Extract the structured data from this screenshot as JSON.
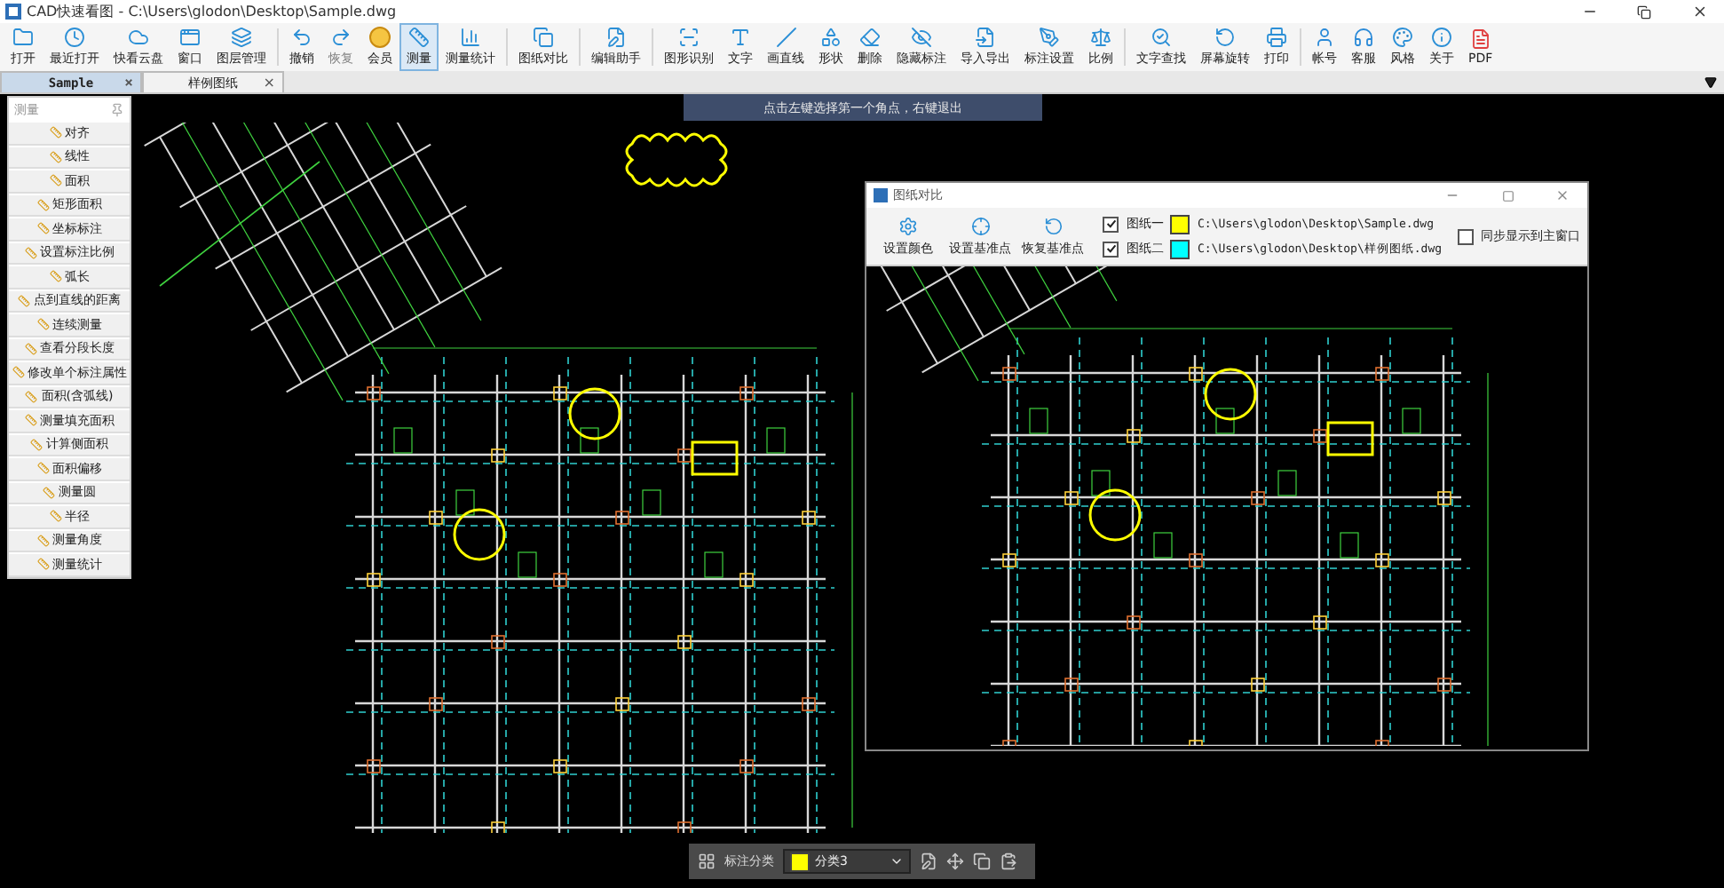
{
  "window": {
    "title": "CAD快速看图 - C:\\Users\\glodon\\Desktop\\Sample.dwg"
  },
  "toolbar": [
    {
      "label": "打开",
      "selected": false,
      "disabled": false
    },
    {
      "label": "最近打开",
      "selected": false,
      "disabled": false
    },
    {
      "label": "快看云盘",
      "selected": false,
      "disabled": false
    },
    {
      "label": "窗口",
      "selected": false,
      "disabled": false
    },
    {
      "label": "图层管理",
      "selected": false,
      "disabled": false
    },
    {
      "label": "撤销",
      "selected": false,
      "disabled": false
    },
    {
      "label": "恢复",
      "selected": false,
      "disabled": true
    },
    {
      "label": "会员",
      "selected": false,
      "disabled": false
    },
    {
      "label": "测量",
      "selected": true,
      "disabled": false
    },
    {
      "label": "测量统计",
      "selected": false,
      "disabled": false
    },
    {
      "label": "图纸对比",
      "selected": false,
      "disabled": false
    },
    {
      "label": "编辑助手",
      "selected": false,
      "disabled": false
    },
    {
      "label": "图形识别",
      "selected": false,
      "disabled": false
    },
    {
      "label": "文字",
      "selected": false,
      "disabled": false
    },
    {
      "label": "画直线",
      "selected": false,
      "disabled": false
    },
    {
      "label": "形状",
      "selected": false,
      "disabled": false
    },
    {
      "label": "删除",
      "selected": false,
      "disabled": false
    },
    {
      "label": "隐藏标注",
      "selected": false,
      "disabled": false
    },
    {
      "label": "导入导出",
      "selected": false,
      "disabled": false
    },
    {
      "label": "标注设置",
      "selected": false,
      "disabled": false
    },
    {
      "label": "比例",
      "selected": false,
      "disabled": false
    },
    {
      "label": "文字查找",
      "selected": false,
      "disabled": false
    },
    {
      "label": "屏幕旋转",
      "selected": false,
      "disabled": false
    },
    {
      "label": "打印",
      "selected": false,
      "disabled": false
    },
    {
      "label": "帐号",
      "selected": false,
      "disabled": false
    },
    {
      "label": "客服",
      "selected": false,
      "disabled": false
    },
    {
      "label": "风格",
      "selected": false,
      "disabled": false
    },
    {
      "label": "关于",
      "selected": false,
      "disabled": false
    },
    {
      "label": "PDF",
      "selected": false,
      "disabled": false
    }
  ],
  "tabs": [
    {
      "label": "Sample",
      "selected": true,
      "close": "×"
    },
    {
      "label": "样例图纸",
      "selected": false,
      "close": "×"
    }
  ],
  "measure_panel": {
    "title": "测量",
    "items": [
      "对齐",
      "线性",
      "面积",
      "矩形面积",
      "坐标标注",
      "设置标注比例",
      "弧长",
      "点到直线的距离",
      "连续测量",
      "查看分段长度",
      "修改单个标注属性",
      "面积(含弧线)",
      "测量填充面积",
      "计算侧面积",
      "面积偏移",
      "测量圆",
      "半径",
      "测量角度",
      "测量统计"
    ]
  },
  "hint": "点击左键选择第一个角点，右键退出",
  "compare_window": {
    "title": "图纸对比",
    "buttons": [
      "设置颜色",
      "设置基准点",
      "恢复基准点"
    ],
    "drawings": [
      {
        "label": "图纸一",
        "checked": true,
        "color": "#ffff00",
        "path": "C:\\Users\\glodon\\Desktop\\Sample.dwg"
      },
      {
        "label": "图纸二",
        "checked": true,
        "color": "#00ffff",
        "path": "C:\\Users\\glodon\\Desktop\\样例图纸.dwg"
      }
    ],
    "sync": {
      "label": "同步显示到主窗口",
      "checked": false
    }
  },
  "annotation_bar": {
    "label": "标注分类",
    "category": {
      "name": "分类3",
      "color": "#ffff00"
    }
  }
}
